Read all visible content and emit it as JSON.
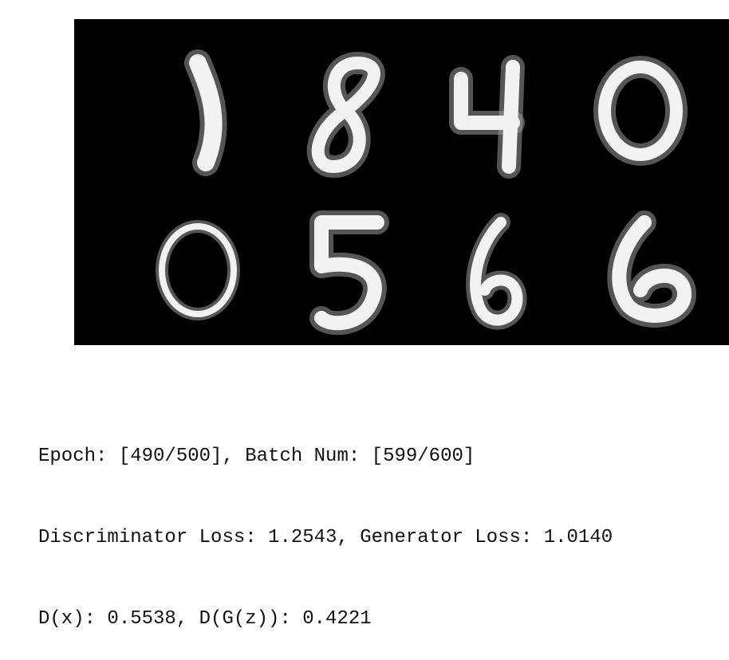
{
  "generated_samples": {
    "digits": [
      "1",
      "8",
      "4",
      "0",
      "0",
      "5",
      "6",
      "6"
    ]
  },
  "log": {
    "line1": "Epoch: [490/500], Batch Num: [599/600]",
    "line2": "Discriminator Loss: 1.2543, Generator Loss: 1.0140",
    "line3": "D(x): 0.5538, D(G(z)): 0.4221"
  }
}
